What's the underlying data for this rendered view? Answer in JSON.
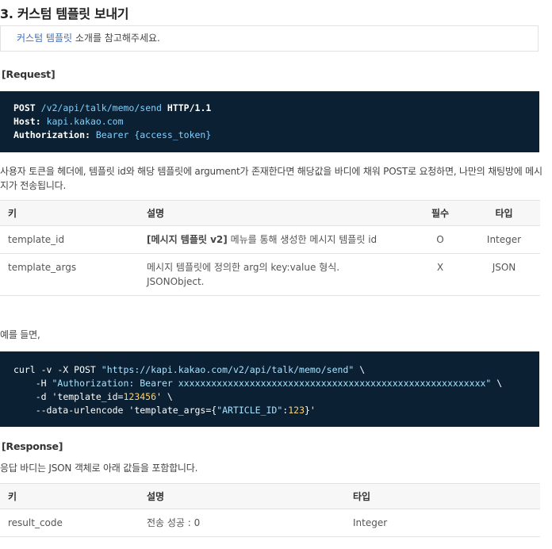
{
  "section_title": "3. 커스텀 템플릿 보내기",
  "notice": {
    "link": "커스텀 템플릿",
    "rest": " 소개를 참고해주세요."
  },
  "request_label": "[Request]",
  "request_code": {
    "method": "POST",
    "path": "/v2/api/talk/memo/send",
    "protocol": "HTTP/1.1",
    "host_key": "Host:",
    "host_value": "kapi.kakao.com",
    "auth_key": "Authorization:",
    "auth_value": "Bearer {access_token}"
  },
  "request_desc": "사용자 토큰을 헤더에, 템플릿 id와 해당 템플릿에 argument가 존재한다면 해당값을 바디에 채워 POST로 요청하면, 나만의 채팅방에 메시지가 전송됩니다.",
  "request_desc_line2": "메시지가 전송됩니다.",
  "request_table": {
    "headers": [
      "키",
      "설명",
      "필수",
      "타입"
    ],
    "rows": [
      {
        "key": "template_id",
        "desc_bold": "[메시지 템플릿 v2]",
        "desc": " 메뉴를 통해 생성한 메시지 템플릿 id",
        "required": "O",
        "type": "Integer"
      },
      {
        "key": "template_args",
        "desc_bold": "",
        "desc": "메시지 템플릿에 정의한 arg의 key:value 형식.",
        "desc2": "JSONObject.",
        "required": "X",
        "type": "JSON"
      }
    ]
  },
  "example_label": "예를 들면,",
  "curl": {
    "line1_cmd": "curl -v -X POST ",
    "line1_url": "\"https://kapi.kakao.com/v2/api/talk/memo/send\"",
    "line1_end": " \\",
    "line2_flag": "    -H ",
    "line2_str": "\"Authorization: Bearer xxxxxxxxxxxxxxxxxxxxxxxxxxxxxxxxxxxxxxxxxxxxxxxxxxxxxxxx\"",
    "line2_end": " \\",
    "line3_flag": "    -d ",
    "line3_a": "'template_id=",
    "line3_num": "123456",
    "line3_b": "'",
    "line3_end": " \\",
    "line4_flag": "    --data-urlencode ",
    "line4_a": "'template_args={",
    "line4_key": "\"ARTICLE_ID\"",
    "line4_colon": ":",
    "line4_num": "123",
    "line4_b": "}'"
  },
  "response_label": "[Response]",
  "response_desc": "응답 바디는 JSON 객체로 아래 값들을 포함합니다.",
  "response_table": {
    "headers": [
      "키",
      "설명",
      "타입"
    ],
    "rows": [
      {
        "key": "result_code",
        "desc": "전송 성공 : 0",
        "type": "Integer"
      }
    ]
  }
}
